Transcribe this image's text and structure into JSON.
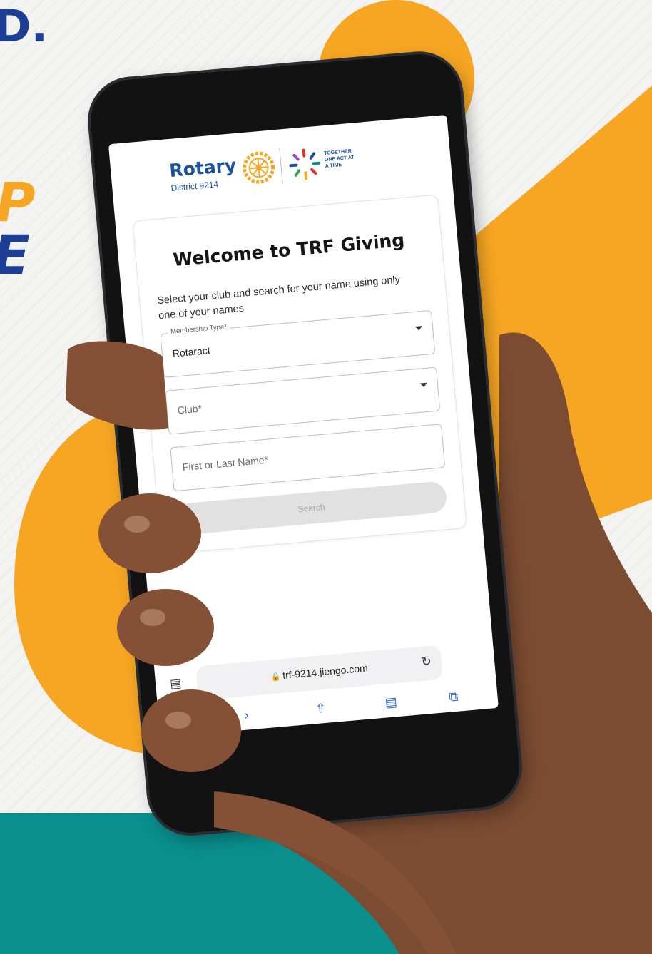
{
  "poster": {
    "fragment_top": "D.",
    "fragment_p": "P",
    "fragment_e": "E"
  },
  "colors": {
    "orange": "#f6a623",
    "teal": "#0a8f8d",
    "rotary_blue": "#1c4fa0",
    "skin": "#7b4b32"
  },
  "logo": {
    "brand": "Rotary",
    "district": "District 9214",
    "wheel_icon": "rotary-wheel-icon",
    "campaign_icon": "together-icon",
    "tagline": "TOGETHER\nONE ACT AT\nA TIME"
  },
  "card": {
    "title": "Welcome to TRF Giving",
    "description": "Select your club and search for your name using only one of your names"
  },
  "form": {
    "membership_type": {
      "label": "Membership Type*",
      "value": "Rotaract"
    },
    "club": {
      "placeholder": "Club*"
    },
    "name": {
      "placeholder": "First or Last Name*"
    },
    "search_label": "Search"
  },
  "browser": {
    "url": "trf-9214.jiengo.com",
    "lock_icon": "lock-icon",
    "reload_icon": "reload-icon",
    "reader_icon": "reader-icon",
    "nav_icons": [
      "back-icon",
      "forward-icon",
      "share-icon",
      "bookmarks-icon",
      "tabs-icon"
    ]
  }
}
